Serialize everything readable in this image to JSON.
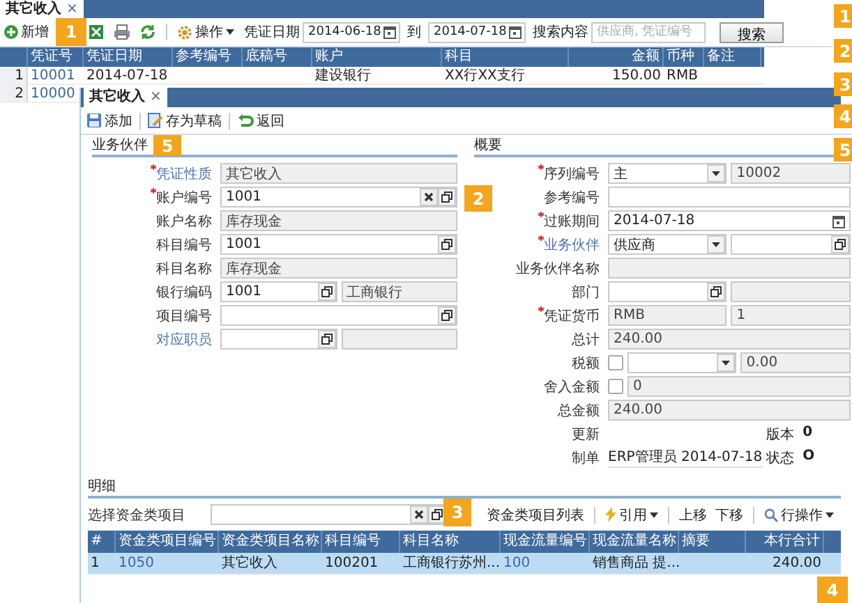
{
  "tabs": [
    {
      "label": "其它收入",
      "close": "×",
      "selected": true
    }
  ],
  "toolbar": {
    "new": "新增",
    "operate": "操作",
    "date_label": "凭证日期",
    "date_from": "2014-06-18",
    "to_label": "到",
    "date_to": "2014-07-18",
    "search_label": "搜索内容",
    "search_placeholder": "供应商, 凭证编号",
    "search_button": "搜索"
  },
  "grid": {
    "columns": [
      {
        "label": "凭证号",
        "link": true
      },
      {
        "label": "凭证日期"
      },
      {
        "label": "参考编号"
      },
      {
        "label": "底稿号"
      },
      {
        "label": "账户"
      },
      {
        "label": "科目"
      },
      {
        "label": "金额",
        "numeric": true
      },
      {
        "label": "币种"
      },
      {
        "label": "备注"
      }
    ],
    "rows": [
      {
        "number": "1",
        "cells": [
          "10001",
          "2014-07-18",
          null,
          null,
          "建设银行",
          "XX行XX支行",
          "150.00",
          "RMB",
          null
        ]
      },
      {
        "number": "2",
        "cells": [
          "10000"
        ]
      }
    ]
  },
  "panel": {
    "tab": {
      "label": "其它收入",
      "close": "×",
      "selected": true
    },
    "toolbar": [
      {
        "kind": "save",
        "label": "添加"
      },
      {
        "kind": "draft",
        "label": "存为草稿"
      },
      {
        "kind": "back",
        "label": "返回"
      }
    ],
    "left": {
      "title": "业务伙伴",
      "fields": [
        {
          "label": "凭证性质",
          "required": true,
          "link": true,
          "inputs": [
            {
              "kind": "text",
              "value": "其它收入",
              "disabled": true
            }
          ]
        },
        {
          "label": "账户编号",
          "required": true,
          "link": false,
          "inputs": [
            {
              "kind": "lookup",
              "value": "1001",
              "clear": true,
              "disabled": false
            }
          ]
        },
        {
          "label": "账户名称",
          "required": false,
          "link": false,
          "inputs": [
            {
              "kind": "text",
              "value": "库存现金",
              "disabled": true
            }
          ]
        },
        {
          "label": "科目编号",
          "required": false,
          "link": false,
          "inputs": [
            {
              "kind": "lookup",
              "value": "1001",
              "clear": false,
              "disabled": false
            }
          ]
        },
        {
          "label": "科目名称",
          "required": false,
          "link": false,
          "inputs": [
            {
              "kind": "text",
              "value": "库存现金",
              "disabled": true
            }
          ]
        },
        {
          "label": "银行编码",
          "required": false,
          "link": false,
          "inputs": [
            {
              "kind": "lookup",
              "value": "1001",
              "clear": false,
              "disabled": false
            },
            {
              "kind": "text",
              "value": "工商银行",
              "disabled": true
            }
          ]
        },
        {
          "label": "项目编号",
          "required": false,
          "link": false,
          "inputs": [
            {
              "kind": "lookup",
              "clear": false,
              "disabled": false
            }
          ]
        },
        {
          "label": "对应职员",
          "required": false,
          "link": true,
          "inputs": [
            {
              "kind": "lookup",
              "clear": false,
              "disabled": false
            },
            {
              "kind": "text",
              "disabled": true
            }
          ]
        }
      ]
    },
    "right": {
      "title": "概要",
      "fields": [
        {
          "label": "序列编号",
          "required": true,
          "link": false,
          "inputs": [
            {
              "kind": "select",
              "value": "主",
              "disabled": false
            },
            {
              "kind": "text",
              "value": "10002",
              "disabled": true
            }
          ]
        },
        {
          "label": "参考编号",
          "required": false,
          "link": false,
          "inputs": [
            {
              "kind": "text",
              "disabled": false
            }
          ]
        },
        {
          "label": "过账期间",
          "required": true,
          "link": false,
          "inputs": [
            {
              "kind": "date",
              "value": "2014-07-18",
              "disabled": false
            }
          ]
        },
        {
          "label": "业务伙伴",
          "required": true,
          "link": true,
          "inputs": [
            {
              "kind": "select",
              "value": "供应商",
              "disabled": false
            },
            {
              "kind": "lookup",
              "clear": false,
              "disabled": false
            }
          ]
        },
        {
          "label": "业务伙伴名称",
          "required": false,
          "link": false,
          "inputs": [
            {
              "kind": "text",
              "disabled": true
            }
          ]
        },
        {
          "label": "部门",
          "required": false,
          "link": false,
          "inputs": [
            {
              "kind": "lookup",
              "clear": false,
              "disabled": false
            },
            {
              "kind": "text",
              "disabled": true
            }
          ]
        },
        {
          "label": "凭证货币",
          "required": true,
          "link": false,
          "inputs": [
            {
              "kind": "text",
              "value": "RMB",
              "disabled": true
            },
            {
              "kind": "text",
              "value": "1",
              "disabled": true
            }
          ]
        },
        {
          "label": "总计",
          "required": false,
          "link": false,
          "inputs": [
            {
              "kind": "text",
              "value": "240.00",
              "disabled": true
            }
          ]
        },
        {
          "label": "税额",
          "required": false,
          "link": false,
          "inputs": [
            {
              "kind": "check",
              "checked": false
            },
            {
              "kind": "select",
              "disabled": false
            },
            {
              "kind": "text",
              "value": "0.00",
              "disabled": true
            }
          ]
        },
        {
          "label": "舍入金额",
          "required": false,
          "link": false,
          "inputs": [
            {
              "kind": "check",
              "checked": false
            },
            {
              "kind": "text",
              "value": "0",
              "disabled": true
            }
          ]
        },
        {
          "label": "总金额",
          "required": false,
          "link": false,
          "inputs": [
            {
              "kind": "text",
              "value": "240.00",
              "disabled": true
            }
          ]
        },
        {
          "label": "更新",
          "required": false,
          "link": false,
          "inputs": [
            {
              "kind": "pair",
              "label": "版本",
              "value": "0"
            }
          ]
        },
        {
          "label": "制单",
          "required": false,
          "link": false,
          "inputs": [
            {
              "kind": "plain",
              "value": "ERP管理员 2014-07-18"
            },
            {
              "kind": "pair",
              "label": "状态",
              "value": "O"
            }
          ]
        }
      ]
    },
    "detail": {
      "title": "明细",
      "picker_label": "选择资金类项目",
      "actions": [
        {
          "kind": "list",
          "label": "资金类项目列表"
        },
        {
          "kind": "quote",
          "label": "引用",
          "menu": true
        },
        {
          "kind": "up",
          "label": "上移"
        },
        {
          "kind": "down",
          "label": "下移"
        },
        {
          "kind": "rowop",
          "label": "行操作",
          "menu": true
        }
      ],
      "columns": [
        {
          "label": "#"
        },
        {
          "label": "资金类项目编号",
          "link": true
        },
        {
          "label": "资金类项目名称"
        },
        {
          "label": "科目编号"
        },
        {
          "label": "科目名称"
        },
        {
          "label": "现金流量编号",
          "link": true
        },
        {
          "label": "现金流量名称"
        },
        {
          "label": "摘要"
        },
        {
          "label": "本行合计",
          "numeric": true
        }
      ],
      "rows": [
        {
          "selected": true,
          "cells": [
            "1",
            "1050",
            "其它收入",
            "100201",
            "工商银行苏州...",
            "100",
            "销售商品 提...",
            null,
            "240.00"
          ]
        }
      ]
    }
  },
  "callouts": [
    {
      "number": "1"
    },
    {
      "number": "1"
    },
    {
      "number": "2"
    },
    {
      "number": "3"
    },
    {
      "number": "4"
    },
    {
      "number": "5"
    },
    {
      "number": "5"
    },
    {
      "number": "2"
    },
    {
      "number": "3"
    },
    {
      "number": "4"
    }
  ]
}
